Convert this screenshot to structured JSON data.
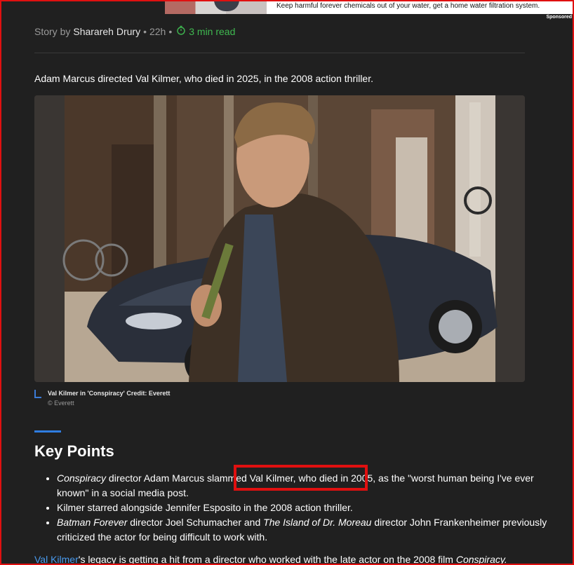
{
  "ad": {
    "text": "Keep harmful forever chemicals out of your water, get a home water filtration system.",
    "sponsored_label": "Sponsored"
  },
  "byline": {
    "prefix": "Story by",
    "author": "Sharareh Drury",
    "age": "22h",
    "read_time": "3 min read"
  },
  "lead": "Adam Marcus directed Val Kilmer, who died in 2025, in the 2008 action thriller.",
  "photo": {
    "caption": "Val Kilmer in 'Conspiracy' Credit: Everett",
    "credit": "© Everett"
  },
  "key_points": {
    "title": "Key Points",
    "items": [
      {
        "em": "Conspiracy",
        "text": " director Adam Marcus slammed Val Kilmer, who died in 2005, as the \"worst human being I've ever known\" in a social media post."
      },
      {
        "em": "",
        "text": "Kilmer starred alongside Jennifer Esposito in the 2008 action thriller."
      },
      {
        "em": "Batman Forever",
        "text": " director Joel Schumacher and ",
        "em2": "The Island of Dr. Moreau",
        "text2": " director John Frankenheimer previously criticized the actor for being difficult to work with."
      }
    ]
  },
  "body": {
    "link": "Val Kilmer",
    "text": "'s legacy is getting a hit from a director who worked with the late actor on the 2008 film ",
    "em": "Conspiracy."
  },
  "colors": {
    "background": "#202020",
    "accent": "#2f7de1",
    "highlight": "#e01010",
    "read_time": "#3fb950"
  }
}
